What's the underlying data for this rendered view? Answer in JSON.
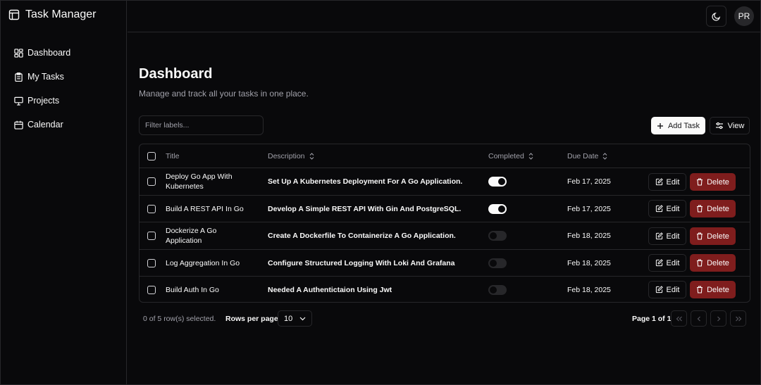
{
  "app": {
    "title": "Task Manager"
  },
  "sidebar": {
    "items": [
      {
        "label": "Dashboard",
        "icon": "dashboard-icon"
      },
      {
        "label": "My Tasks",
        "icon": "clipboard-icon"
      },
      {
        "label": "Projects",
        "icon": "presentation-icon"
      },
      {
        "label": "Calendar",
        "icon": "calendar-icon"
      }
    ]
  },
  "header": {
    "avatar_initials": "PR",
    "theme_icon": "moon-icon"
  },
  "page": {
    "title": "Dashboard",
    "subtitle": "Manage and track all your tasks in one place."
  },
  "toolbar": {
    "filter_placeholder": "Filter labels...",
    "add_label": "Add Task",
    "view_label": "View"
  },
  "table": {
    "columns": {
      "title": "Title",
      "description": "Description",
      "completed": "Completed",
      "due_date": "Due Date"
    },
    "edit_label": "Edit",
    "delete_label": "Delete",
    "rows": [
      {
        "title": "Deploy Go App With Kubernetes",
        "description": "Set Up A Kubernetes Deployment For A Go Application.",
        "completed": true,
        "due_date": "Feb 17, 2025"
      },
      {
        "title": "Build A REST API In Go",
        "description": "Develop A Simple REST API With Gin And PostgreSQL.",
        "completed": true,
        "due_date": "Feb 17, 2025"
      },
      {
        "title": "Dockerize A Go Application",
        "description": "Create A Dockerfile To Containerize A Go Application.",
        "completed": false,
        "due_date": "Feb 18, 2025"
      },
      {
        "title": "Log Aggregation In Go",
        "description": "Configure Structured Logging With Loki And Grafana",
        "completed": false,
        "due_date": "Feb 18, 2025"
      },
      {
        "title": "Build Auth In Go",
        "description": "Needed A Authentictaion Using Jwt",
        "completed": false,
        "due_date": "Feb 18, 2025"
      }
    ]
  },
  "footer": {
    "selected_text": "0 of 5 row(s) selected.",
    "rows_per_page_label": "Rows per page",
    "rows_per_page_value": "10",
    "page_info": "Page 1 of 1"
  },
  "colors": {
    "background": "#09090b",
    "border": "#27272a",
    "destructive": "#7f1d1d",
    "muted_text": "#a1a1aa"
  }
}
